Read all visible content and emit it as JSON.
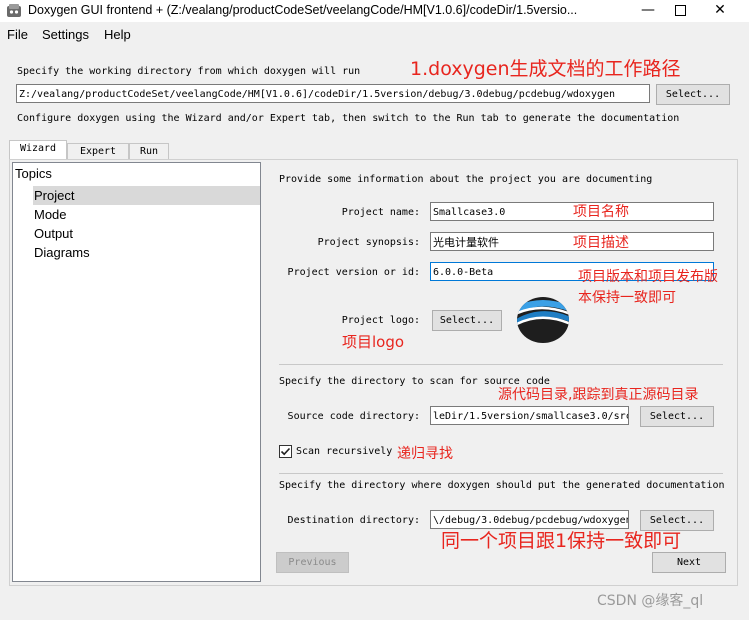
{
  "window": {
    "title": "Doxygen GUI frontend + (Z:/vealang/productCodeSet/veelangCode/HM[V1.0.6]/codeDir/1.5versio...",
    "app_icon": "doxygen-app-icon",
    "controls": [
      "minimize-icon",
      "maximize-icon",
      "close-icon"
    ]
  },
  "menu": {
    "file": "File",
    "settings": "Settings",
    "help": "Help"
  },
  "workdir": {
    "prompt": "Specify the working directory from which doxygen will run",
    "path": "Z:/vealang/productCodeSet/veelangCode/HM[V1.0.6]/codeDir/1.5version/debug/3.0debug/pcdebug/wdoxygen",
    "select_label": "Select...",
    "configure_hint": "Configure doxygen using the Wizard and/or Expert tab, then switch to the Run tab to generate the documentation"
  },
  "tabs": [
    {
      "label": "Wizard",
      "active": true
    },
    {
      "label": "Expert",
      "active": false
    },
    {
      "label": "Run",
      "active": false
    }
  ],
  "topics": {
    "heading": "Topics",
    "items": [
      {
        "label": "Project",
        "selected": true
      },
      {
        "label": "Mode",
        "selected": false
      },
      {
        "label": "Output",
        "selected": false
      },
      {
        "label": "Diagrams",
        "selected": false
      }
    ]
  },
  "project": {
    "intro": "Provide some information about the project you are documenting",
    "name_label": "Project name:",
    "name_value": "Smallcase3.0",
    "synopsis_label": "Project synopsis:",
    "synopsis_value": "光电计量软件",
    "version_label": "Project version or id:",
    "version_value": "6.0.0-Beta",
    "logo_label": "Project logo:",
    "logo_select": "Select..."
  },
  "source": {
    "intro": "Specify the directory to scan for source code",
    "label": "Source code directory:",
    "value": "leDir/1.5version/smallcase3.0/src",
    "select_label": "Select...",
    "scan_label": "Scan recursively",
    "scan_checked": true
  },
  "destination": {
    "intro": "Specify the directory where doxygen should put the generated documentation",
    "label": "Destination directory:",
    "value": "\\/debug/3.0debug/pcdebug/wdoxygen",
    "select_label": "Select..."
  },
  "nav": {
    "previous": "Previous",
    "next": "Next"
  },
  "annotations": {
    "workdir": "1.doxygen生成文档的工作路径",
    "name": "项目名称",
    "synopsis": "项目描述",
    "version_line1": "项目版本和项目发布版",
    "version_line2": "本保持一致即可",
    "logo": "项目logo",
    "source": "源代码目录,跟踪到真正源码目录",
    "scan": "递归寻找",
    "dest": "同一个项目跟1保持一致即可"
  },
  "watermark": "CSDN @缘客_ql",
  "colors": {
    "annotation": "#e8251e",
    "selection": "#d9d9d9",
    "window_bg": "#f0f0f0"
  }
}
